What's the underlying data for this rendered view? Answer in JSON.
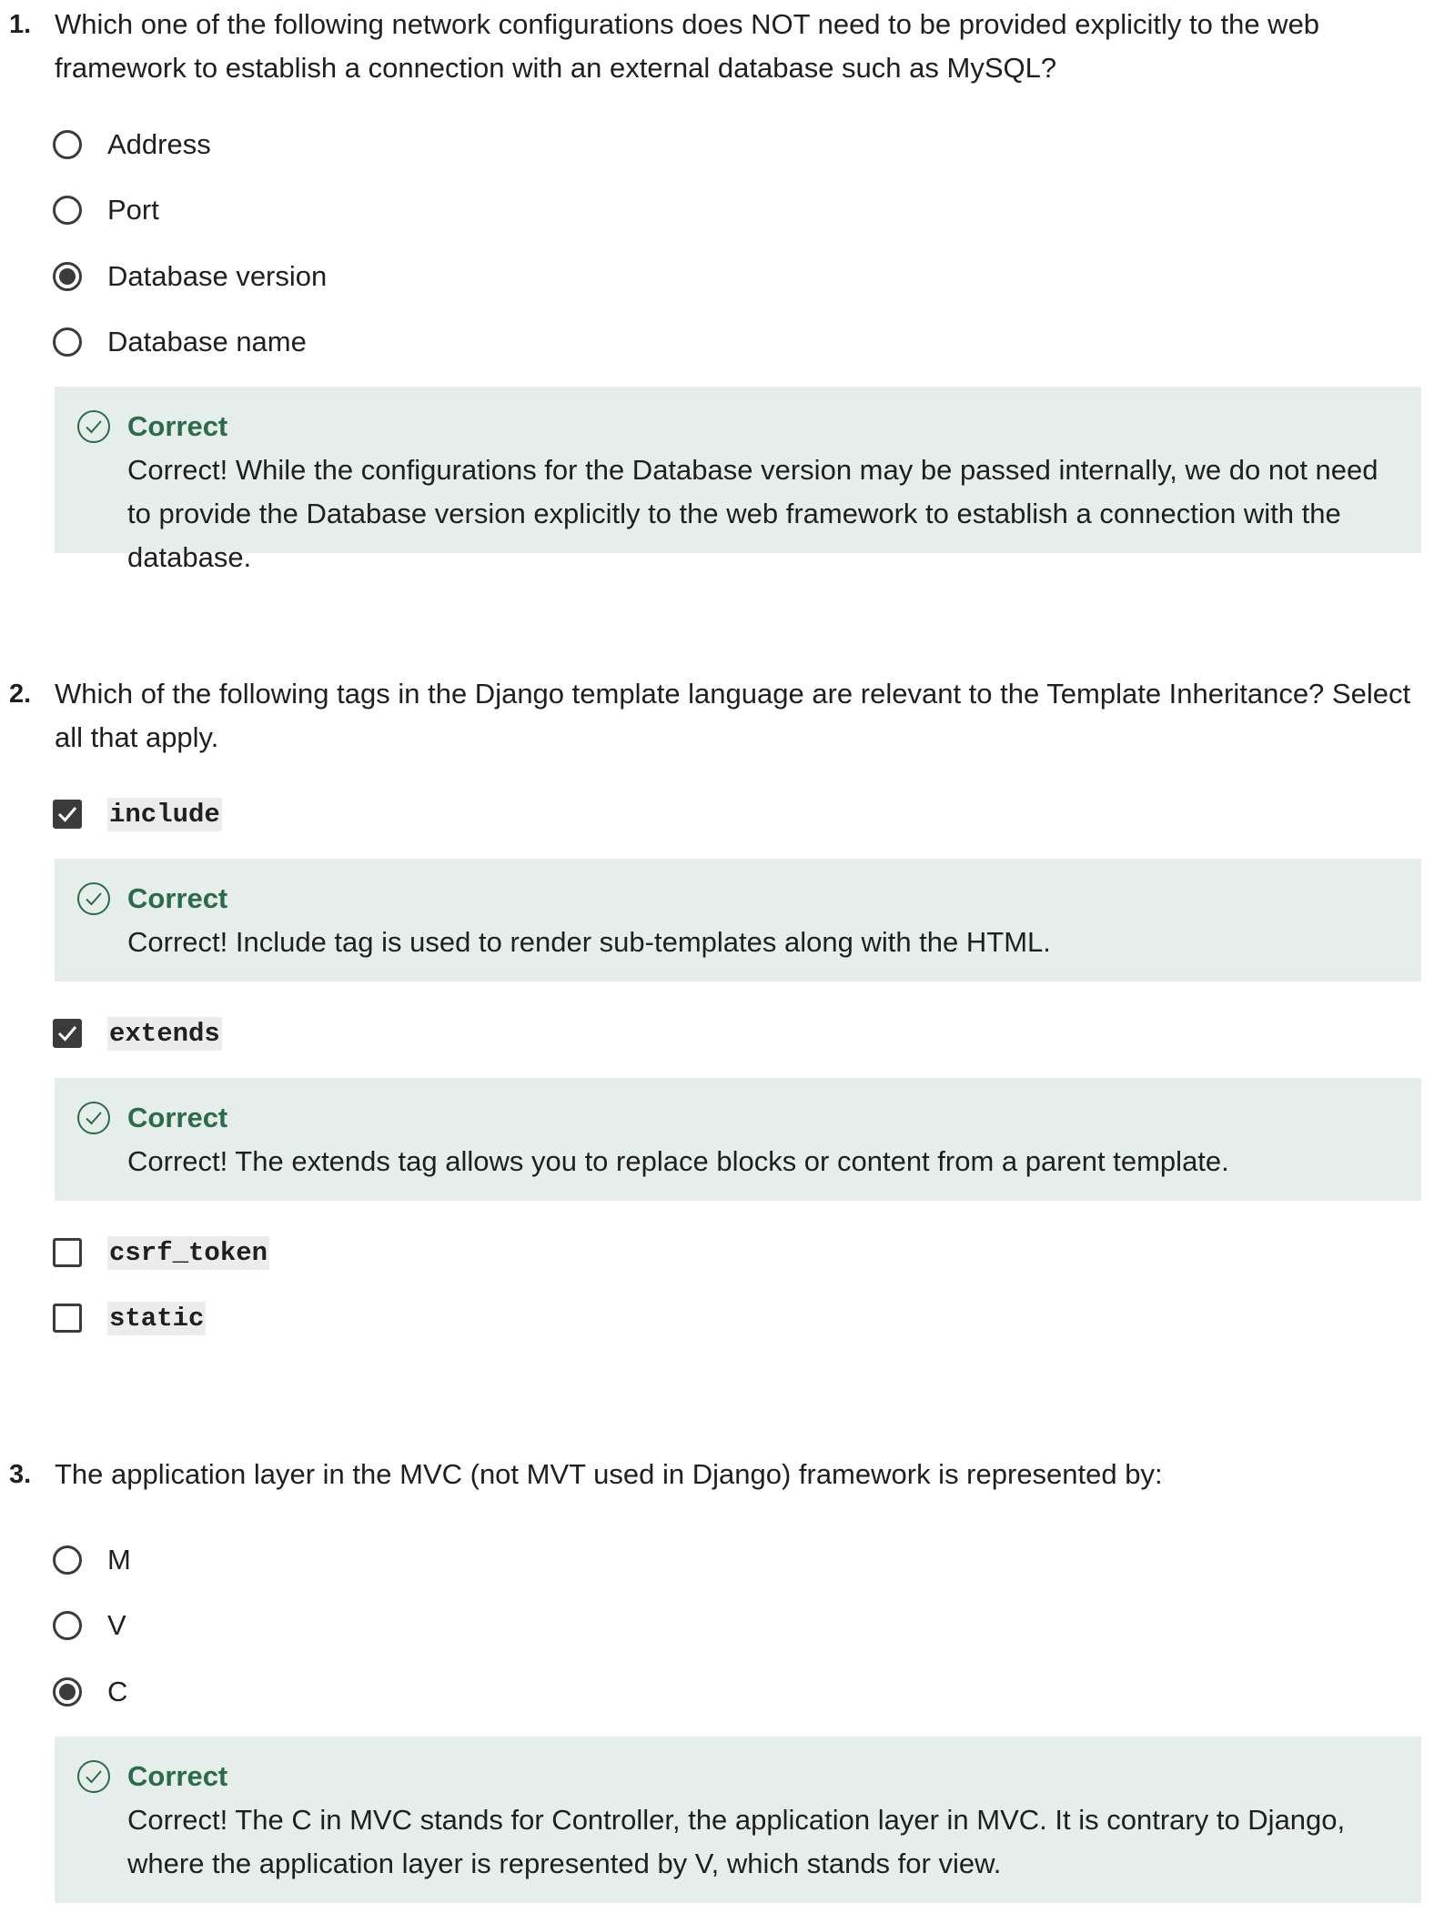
{
  "questions": [
    {
      "number": "1.",
      "text": "Which one of the following network configurations does NOT need to be provided explicitly to the web framework to establish a connection with an external database such as MySQL?",
      "options": [
        {
          "label": "Address",
          "checked": false
        },
        {
          "label": "Port",
          "checked": false
        },
        {
          "label": "Database version",
          "checked": true
        },
        {
          "label": "Database name",
          "checked": false
        }
      ],
      "feedback": {
        "title": "Correct",
        "text": "Correct! While the configurations for the Database version may be passed internally, we do not need to provide the Database version explicitly to the web framework to establish a connection with the database."
      }
    },
    {
      "number": "2.",
      "text": "Which of the following tags in the Django template language are relevant to the Template Inheritance? Select all that apply.",
      "options": [
        {
          "label": "include",
          "checked": true
        },
        {
          "label": "extends",
          "checked": true
        },
        {
          "label": "csrf_token",
          "checked": false
        },
        {
          "label": "static",
          "checked": false
        }
      ],
      "feedbacks": [
        {
          "title": "Correct",
          "text": "Correct! Include tag is used to render sub-templates along with the HTML."
        },
        {
          "title": "Correct",
          "text": "Correct! The extends tag allows you to replace blocks or content from a parent template."
        }
      ]
    },
    {
      "number": "3.",
      "text": "The application layer in the MVC (not MVT used in Django) framework is represented by:",
      "options": [
        {
          "label": "M",
          "checked": false
        },
        {
          "label": "V",
          "checked": false
        },
        {
          "label": "C",
          "checked": true
        }
      ],
      "feedback": {
        "title": "Correct",
        "text": "Correct! The C in MVC stands for Controller, the application layer in MVC. It is contrary to Django, where the application layer is represented by V, which stands for view."
      }
    }
  ],
  "colors": {
    "feedback_bg": "#e6eeeb",
    "correct_green": "#2c6b4a",
    "control_dark": "#3b3b3b"
  },
  "icons": {
    "feedback": "check-circle-icon",
    "checkbox_mark": "checkmark-icon"
  }
}
